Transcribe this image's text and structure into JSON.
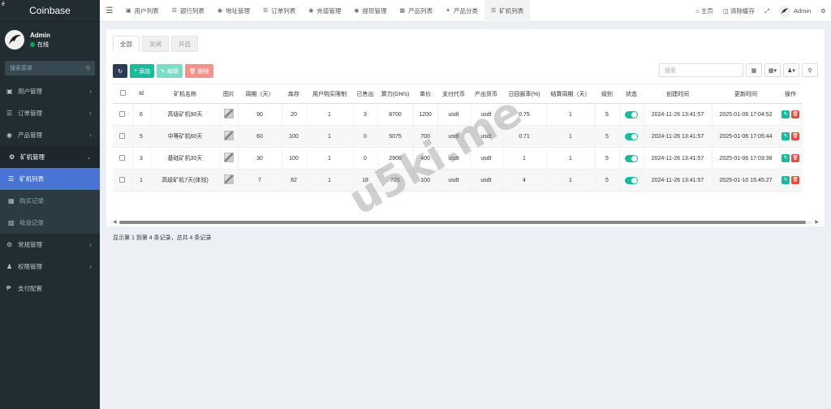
{
  "app": {
    "brand": "Coinbase",
    "corner_glyph": "é"
  },
  "user": {
    "name": "Admin",
    "status": "在线"
  },
  "sidebar": {
    "search_placeholder": "搜索菜单",
    "items": [
      {
        "label": "用户管理",
        "icon": "user-icon"
      },
      {
        "label": "订单管理",
        "icon": "list-icon"
      },
      {
        "label": "产品管理",
        "icon": "product-icon"
      },
      {
        "label": "矿机管理",
        "icon": "miner-icon"
      }
    ],
    "sub_items": [
      {
        "label": "矿机列表",
        "icon": "list-icon"
      },
      {
        "label": "购买记录",
        "icon": "record-icon"
      },
      {
        "label": "收益记录",
        "icon": "income-icon"
      }
    ],
    "items_after": [
      {
        "label": "常规管理",
        "icon": "cog-icon"
      },
      {
        "label": "权限管理",
        "icon": "users-icon"
      },
      {
        "label": "支付配置",
        "icon": "pay-icon"
      }
    ]
  },
  "topnav": {
    "tabs": [
      "用户列表",
      "银行列表",
      "地址管理",
      "订单列表",
      "充值管理",
      "提现管理",
      "产品列表",
      "产品分类",
      "矿机列表"
    ],
    "home": "主页",
    "clear_cache": "清除缓存",
    "admin": "Admin"
  },
  "subtabs": [
    "全部",
    "关闭",
    "开启"
  ],
  "toolbar": {
    "add": "添加",
    "edit": "编辑",
    "delete": "删除",
    "search_placeholder": "搜索"
  },
  "table": {
    "headers": [
      "Id",
      "矿机名称",
      "图片",
      "周期（天）",
      "库存",
      "用户购买限制",
      "已售出",
      "算力(GH/s)",
      "单价",
      "支付代币",
      "产出货币",
      "日回报率(%)",
      "结算周期（天）",
      "级别",
      "状态",
      "创建时间",
      "更新时间",
      "操作"
    ],
    "rows": [
      {
        "id": "6",
        "name": "高级矿机90天",
        "cycle": "90",
        "stock": "20",
        "limit": "1",
        "sold": "3",
        "power": "8700",
        "price": "1200",
        "pay": "usdt",
        "out": "usdt",
        "rate": "0.75",
        "settle": "1",
        "level": "5",
        "created": "2024-11-26 13:41:57",
        "updated": "2025-01-06 17:04:52"
      },
      {
        "id": "5",
        "name": "中等矿机60天",
        "cycle": "60",
        "stock": "100",
        "limit": "1",
        "sold": "0",
        "power": "5075",
        "price": "700",
        "pay": "usdt",
        "out": "usdt",
        "rate": "0.71",
        "settle": "1",
        "level": "5",
        "created": "2024-11-26 13:41:57",
        "updated": "2025-01-06 17:05:44"
      },
      {
        "id": "3",
        "name": "基础矿机30天",
        "cycle": "30",
        "stock": "100",
        "limit": "1",
        "sold": "0",
        "power": "2900",
        "price": "400",
        "pay": "usdt",
        "out": "usdt",
        "rate": "1",
        "settle": "1",
        "level": "5",
        "created": "2024-11-26 13:41:57",
        "updated": "2025-01-06 17:03:38"
      },
      {
        "id": "1",
        "name": "高级矿机7天(体验)",
        "cycle": "7",
        "stock": "82",
        "limit": "1",
        "sold": "18",
        "power": "725",
        "price": "100",
        "pay": "usdt",
        "out": "usdt",
        "rate": "4",
        "settle": "1",
        "level": "5",
        "created": "2024-11-26 13:41:57",
        "updated": "2025-01-10 15:45:27"
      }
    ]
  },
  "footer": "显示第 1 到第 4 条记录，总共 4 条记录",
  "watermark": "u5ki.me"
}
